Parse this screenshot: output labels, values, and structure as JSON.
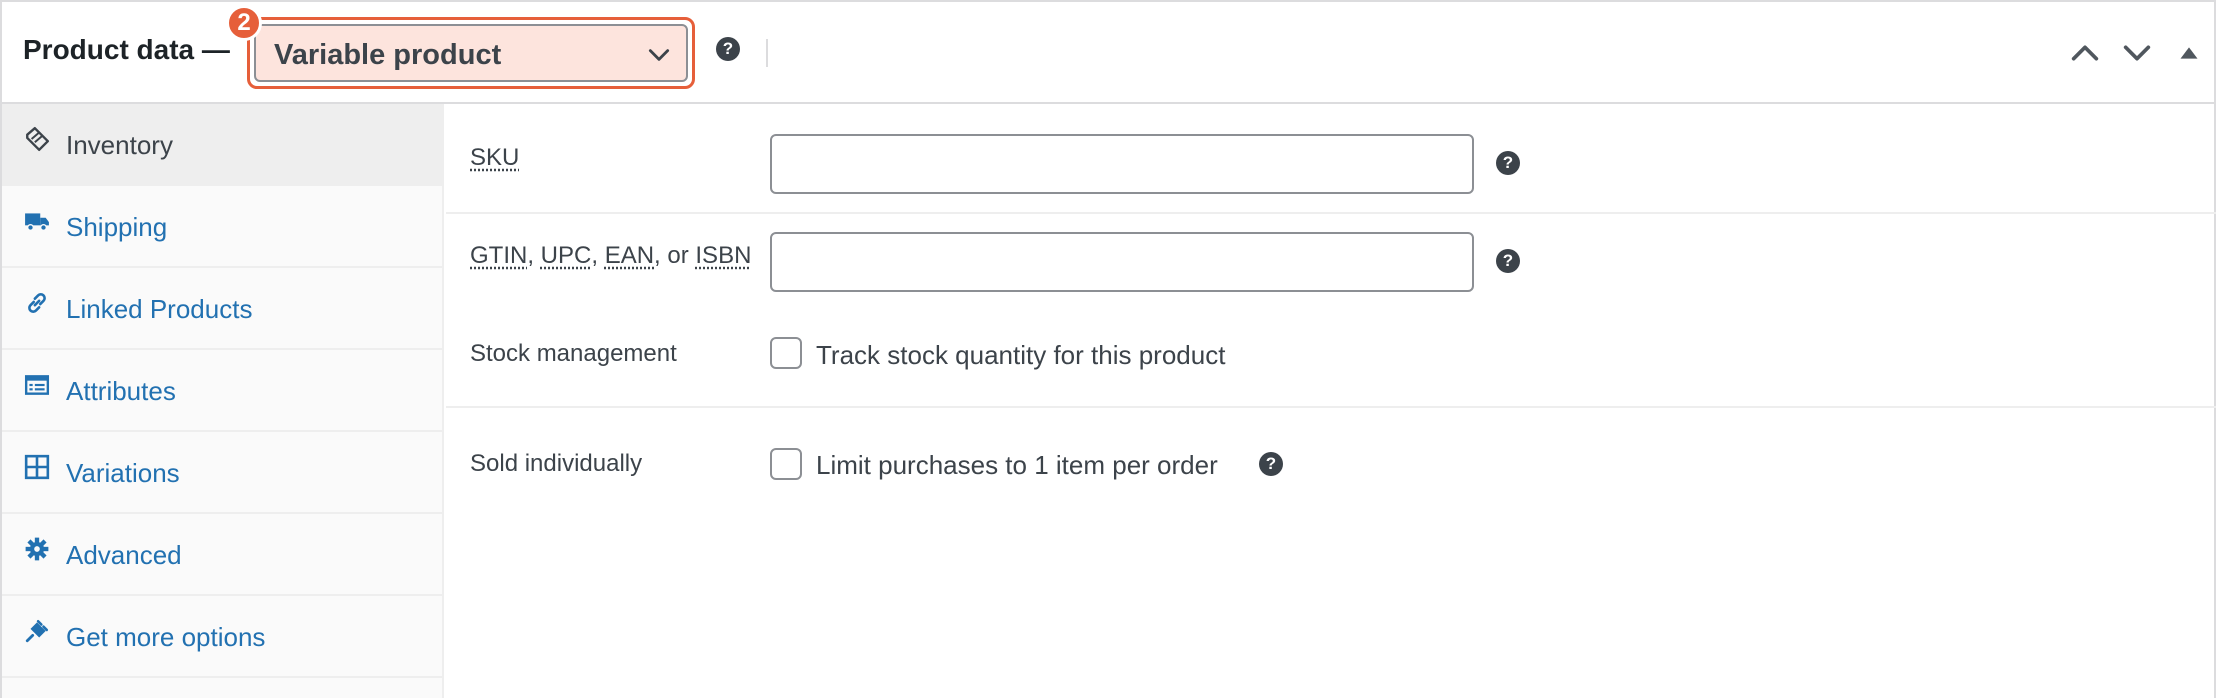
{
  "header": {
    "title": "Product data —",
    "product_type": "Variable product",
    "step_badge": "2",
    "help_glyph": "?"
  },
  "tabs": [
    {
      "label": "Inventory",
      "icon": "tag-icon",
      "active": true
    },
    {
      "label": "Shipping",
      "icon": "truck-icon"
    },
    {
      "label": "Linked Products",
      "icon": "link-icon"
    },
    {
      "label": "Attributes",
      "icon": "list-card-icon"
    },
    {
      "label": "Variations",
      "icon": "grid-icon"
    },
    {
      "label": "Advanced",
      "icon": "gear-icon"
    },
    {
      "label": "Get more options",
      "icon": "plugin-icon"
    }
  ],
  "inventory": {
    "sku_label": "SKU",
    "sku_value": "",
    "gtin_parts": [
      "GTIN",
      ", ",
      "UPC",
      ", ",
      "EAN",
      ", or ",
      "ISBN"
    ],
    "gtin_value": "",
    "stock_label": "Stock management",
    "stock_checkbox_label": "Track stock quantity for this product",
    "stock_checked": false,
    "sold_label": "Sold individually",
    "sold_checkbox_label": "Limit purchases to 1 item per order",
    "sold_checked": false
  },
  "colors": {
    "accent": "#e65f3a",
    "select_bg": "#fde4dd",
    "link": "#2271b1"
  }
}
